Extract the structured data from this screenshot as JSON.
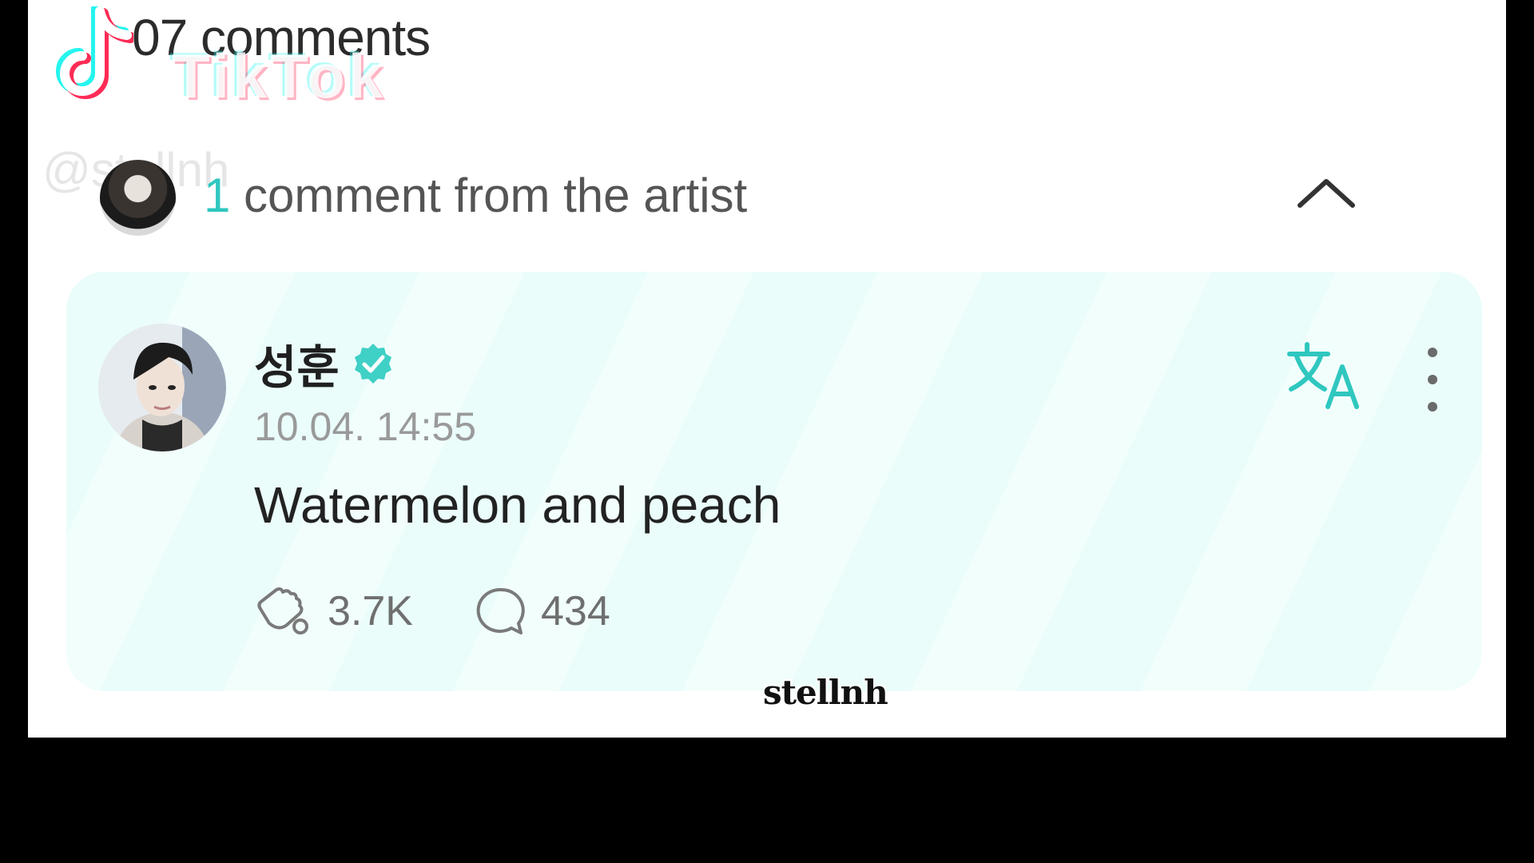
{
  "header": {
    "comments_count_text": "07 comments"
  },
  "tiktok_overlay": {
    "brand": "TikTok",
    "handle": "@stellnh"
  },
  "artist_section": {
    "count": "1",
    "label": "comment from the artist"
  },
  "comment": {
    "author": "성훈",
    "timestamp": "10.04. 14:55",
    "text": "Watermelon and peach",
    "likes": "3.7K",
    "replies": "434"
  },
  "footer": {
    "watermark": "stellnh"
  },
  "colors": {
    "accent": "#2fc7bf",
    "card_bg": "#eafdfb"
  },
  "icons": {
    "collapse": "chevron-up-icon",
    "translate": "translate-icon",
    "more": "more-vertical-icon",
    "verified": "verified-badge-icon",
    "like": "cheer-hands-icon",
    "reply": "speech-bubble-icon"
  }
}
